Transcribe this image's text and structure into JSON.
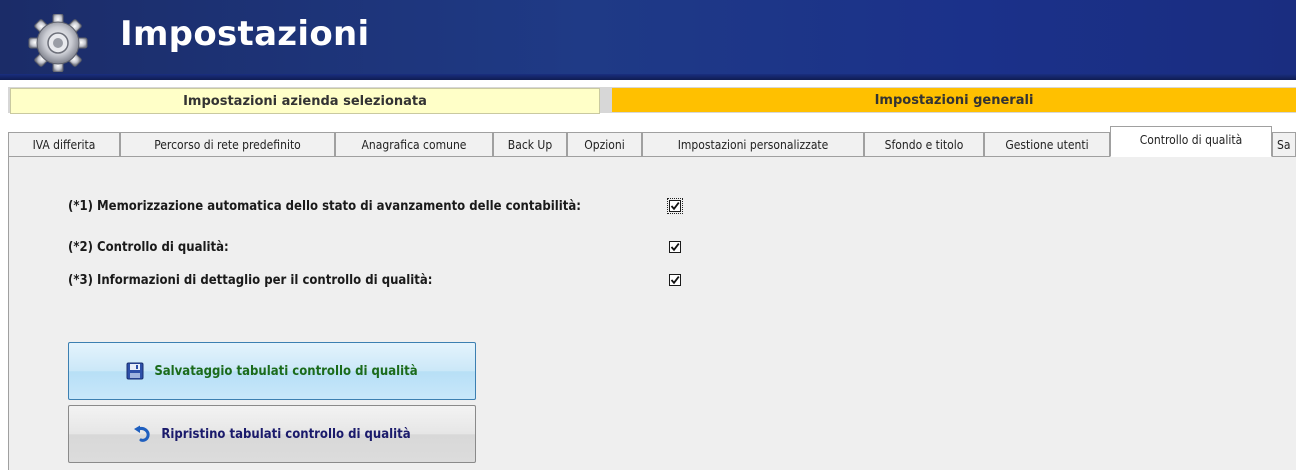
{
  "header": {
    "title": "Impostazioni",
    "icon": "gear-icon"
  },
  "sections": {
    "left_label": "Impostazioni azienda selezionata",
    "right_label": "Impostazioni generali"
  },
  "tabs": [
    {
      "label": "IVA differita"
    },
    {
      "label": "Percorso di rete predefinito"
    },
    {
      "label": "Anagrafica comune"
    },
    {
      "label": "Back Up"
    },
    {
      "label": "Opzioni"
    },
    {
      "label": "Impostazioni personalizzate"
    },
    {
      "label": "Sfondo e titolo"
    },
    {
      "label": "Gestione utenti"
    },
    {
      "label": "Controllo di qualità",
      "active": true
    },
    {
      "label": "Sa"
    }
  ],
  "options": [
    {
      "label": "(*1) Memorizzazione automatica dello stato di avanzamento delle contabilità:",
      "checked": true
    },
    {
      "label": "(*2) Controllo di qualità:",
      "checked": true
    },
    {
      "label": "(*3) Informazioni di dettaglio per il controllo di qualità:",
      "checked": true
    }
  ],
  "buttons": {
    "save_label": "Salvataggio tabulati controllo di qualità",
    "restore_label": "Ripristino tabulati controllo di qualità"
  },
  "colors": {
    "header_bg": "#1f3a86",
    "section_left_bg": "#ffffc8",
    "section_right_bg": "#ffc000",
    "panel_bg": "#efefef",
    "save_text": "#1b6b1b"
  }
}
